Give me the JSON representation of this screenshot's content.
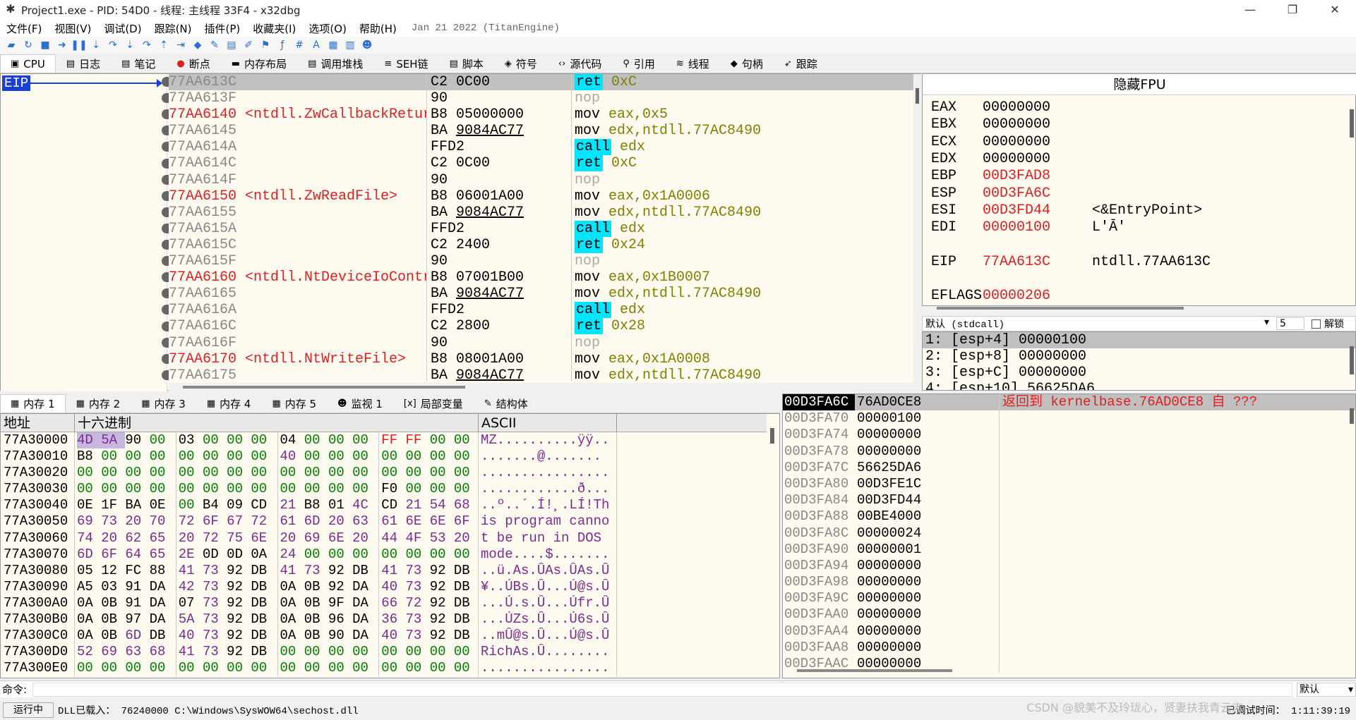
{
  "window": {
    "title": "Project1.exe - PID: 54D0 - 线程: 主线程 33F4 - x32dbg"
  },
  "menu": [
    "文件(F)",
    "视图(V)",
    "调试(D)",
    "跟踪(N)",
    "插件(P)",
    "收藏夹(I)",
    "选项(O)",
    "帮助(H)"
  ],
  "build_date": "Jan 21 2022 (TitanEngine)",
  "toolbar_icons": [
    "open-icon",
    "restart-icon",
    "stop-icon",
    "run-icon",
    "pause-icon",
    "step-into-icon",
    "step-over-icon",
    "step-into-2-icon",
    "step-over-2-icon",
    "run-to-user-icon",
    "trace-icon",
    "scylla-icon",
    "patch-icon",
    "comment-icon",
    "label-icon",
    "bookmark-icon",
    "function-icon",
    "hash-icon",
    "font-icon",
    "calc-icon",
    "notes-icon",
    "about-icon"
  ],
  "top_tabs": [
    {
      "label": "CPU",
      "icon": "cpu-icon"
    },
    {
      "label": "日志",
      "icon": "log-icon"
    },
    {
      "label": "笔记",
      "icon": "notes-icon"
    },
    {
      "label": "断点",
      "icon": "breakpoint-icon"
    },
    {
      "label": "内存布局",
      "icon": "memory-map-icon"
    },
    {
      "label": "调用堆栈",
      "icon": "callstack-icon"
    },
    {
      "label": "SEH链",
      "icon": "seh-icon"
    },
    {
      "label": "脚本",
      "icon": "script-icon"
    },
    {
      "label": "符号",
      "icon": "symbol-icon"
    },
    {
      "label": "源代码",
      "icon": "source-icon"
    },
    {
      "label": "引用",
      "icon": "search-icon"
    },
    {
      "label": "线程",
      "icon": "thread-icon"
    },
    {
      "label": "句柄",
      "icon": "handle-icon"
    },
    {
      "label": "跟踪",
      "icon": "trace-icon"
    }
  ],
  "eip_label": "EIP",
  "disasm": [
    {
      "addr": "77AA613C",
      "bytes": "C2 0C00",
      "op": "ret",
      "args": "0xC",
      "kind": "ret",
      "sel": true
    },
    {
      "addr": "77AA613F",
      "bytes": "90",
      "op": "nop",
      "args": "",
      "kind": "nop"
    },
    {
      "addr": "77AA6140 <ntdll.ZwCallbackRetur",
      "bytes": "B8 05000000",
      "op": "mov",
      "args": "eax,0x5",
      "kind": "mov",
      "label": true
    },
    {
      "addr": "77AA6145",
      "bytes": "BA 9084AC77",
      "op": "mov",
      "args": "edx,ntdll.77AC8490",
      "kind": "mov",
      "u": true
    },
    {
      "addr": "77AA614A",
      "bytes": "FFD2",
      "op": "call",
      "args": "edx",
      "kind": "call"
    },
    {
      "addr": "77AA614C",
      "bytes": "C2 0C00",
      "op": "ret",
      "args": "0xC",
      "kind": "ret"
    },
    {
      "addr": "77AA614F",
      "bytes": "90",
      "op": "nop",
      "args": "",
      "kind": "nop"
    },
    {
      "addr": "77AA6150 <ntdll.ZwReadFile>",
      "bytes": "B8 06001A00",
      "op": "mov",
      "args": "eax,0x1A0006",
      "kind": "mov",
      "label": true
    },
    {
      "addr": "77AA6155",
      "bytes": "BA 9084AC77",
      "op": "mov",
      "args": "edx,ntdll.77AC8490",
      "kind": "mov",
      "u": true
    },
    {
      "addr": "77AA615A",
      "bytes": "FFD2",
      "op": "call",
      "args": "edx",
      "kind": "call"
    },
    {
      "addr": "77AA615C",
      "bytes": "C2 2400",
      "op": "ret",
      "args": "0x24",
      "kind": "ret"
    },
    {
      "addr": "77AA615F",
      "bytes": "90",
      "op": "nop",
      "args": "",
      "kind": "nop"
    },
    {
      "addr": "77AA6160 <ntdll.NtDeviceIoContr",
      "bytes": "B8 07001B00",
      "op": "mov",
      "args": "eax,0x1B0007",
      "kind": "mov",
      "label": true
    },
    {
      "addr": "77AA6165",
      "bytes": "BA 9084AC77",
      "op": "mov",
      "args": "edx,ntdll.77AC8490",
      "kind": "mov",
      "u": true
    },
    {
      "addr": "77AA616A",
      "bytes": "FFD2",
      "op": "call",
      "args": "edx",
      "kind": "call"
    },
    {
      "addr": "77AA616C",
      "bytes": "C2 2800",
      "op": "ret",
      "args": "0x28",
      "kind": "ret"
    },
    {
      "addr": "77AA616F",
      "bytes": "90",
      "op": "nop",
      "args": "",
      "kind": "nop"
    },
    {
      "addr": "77AA6170 <ntdll.NtWriteFile>",
      "bytes": "B8 08001A00",
      "op": "mov",
      "args": "eax,0x1A0008",
      "kind": "mov",
      "label": true
    },
    {
      "addr": "77AA6175",
      "bytes": "BA 9084AC77",
      "op": "mov",
      "args": "edx,ntdll.77AC8490",
      "kind": "mov",
      "u": true
    }
  ],
  "fpu_button": "隐藏FPU",
  "registers": [
    {
      "name": "EAX",
      "value": "00000000",
      "red": false,
      "comment": ""
    },
    {
      "name": "EBX",
      "value": "00000000",
      "red": false,
      "comment": ""
    },
    {
      "name": "ECX",
      "value": "00000000",
      "red": false,
      "comment": ""
    },
    {
      "name": "EDX",
      "value": "00000000",
      "red": false,
      "comment": ""
    },
    {
      "name": "EBP",
      "value": "00D3FAD8",
      "red": true,
      "comment": ""
    },
    {
      "name": "ESP",
      "value": "00D3FA6C",
      "red": true,
      "comment": ""
    },
    {
      "name": "ESI",
      "value": "00D3FD44",
      "red": true,
      "comment": "<&EntryPoint>"
    },
    {
      "name": "EDI",
      "value": "00000100",
      "red": true,
      "comment": "L'Ā'"
    },
    {
      "name": "",
      "value": "",
      "red": false,
      "comment": ""
    },
    {
      "name": "EIP",
      "value": "77AA613C",
      "red": true,
      "comment": "ntdll.77AA613C"
    },
    {
      "name": "",
      "value": "",
      "red": false,
      "comment": ""
    },
    {
      "name": "EFLAGS",
      "value": "00000206",
      "red": true,
      "comment": ""
    }
  ],
  "callconv": {
    "selected": "默认 (stdcall)",
    "count": "5",
    "unlock_label": "解锁"
  },
  "args": [
    {
      "text": "1: [esp+4]  00000100",
      "sel": true
    },
    {
      "text": "2: [esp+8]  00000000",
      "sel": false
    },
    {
      "text": "3: [esp+C]  00000000",
      "sel": false
    },
    {
      "text": "4: [esp+10] 56625DA6",
      "sel": false
    }
  ],
  "bottom_tabs": [
    {
      "label": "内存 1",
      "icon": "dump-icon"
    },
    {
      "label": "内存 2",
      "icon": "dump-icon"
    },
    {
      "label": "内存 3",
      "icon": "dump-icon"
    },
    {
      "label": "内存 4",
      "icon": "dump-icon"
    },
    {
      "label": "内存 5",
      "icon": "dump-icon"
    },
    {
      "label": "监视 1",
      "icon": "watch-icon"
    },
    {
      "label": "局部变量",
      "icon": "locals-icon"
    },
    {
      "label": "结构体",
      "icon": "struct-icon"
    }
  ],
  "dump_headers": {
    "addr": "地址",
    "hex": "十六进制",
    "ascii": "ASCII"
  },
  "dump_rows": [
    {
      "addr": "77A30000",
      "hex": [
        "4D",
        "5A",
        "90",
        "00",
        "03",
        "00",
        "00",
        "00",
        "04",
        "00",
        "00",
        "00",
        "FF",
        "FF",
        "00",
        "00"
      ],
      "ascii": "MZ..........ÿÿ.."
    },
    {
      "addr": "77A30010",
      "hex": [
        "B8",
        "00",
        "00",
        "00",
        "00",
        "00",
        "00",
        "00",
        "40",
        "00",
        "00",
        "00",
        "00",
        "00",
        "00",
        "00"
      ],
      "ascii": ".......@......."
    },
    {
      "addr": "77A30020",
      "hex": [
        "00",
        "00",
        "00",
        "00",
        "00",
        "00",
        "00",
        "00",
        "00",
        "00",
        "00",
        "00",
        "00",
        "00",
        "00",
        "00"
      ],
      "ascii": "................"
    },
    {
      "addr": "77A30030",
      "hex": [
        "00",
        "00",
        "00",
        "00",
        "00",
        "00",
        "00",
        "00",
        "00",
        "00",
        "00",
        "00",
        "F0",
        "00",
        "00",
        "00"
      ],
      "ascii": "............ð..."
    },
    {
      "addr": "77A30040",
      "hex": [
        "0E",
        "1F",
        "BA",
        "0E",
        "00",
        "B4",
        "09",
        "CD",
        "21",
        "B8",
        "01",
        "4C",
        "CD",
        "21",
        "54",
        "68"
      ],
      "ascii": "..º..´.Í!¸.LÍ!Th"
    },
    {
      "addr": "77A30050",
      "hex": [
        "69",
        "73",
        "20",
        "70",
        "72",
        "6F",
        "67",
        "72",
        "61",
        "6D",
        "20",
        "63",
        "61",
        "6E",
        "6E",
        "6F"
      ],
      "ascii": "is program canno"
    },
    {
      "addr": "77A30060",
      "hex": [
        "74",
        "20",
        "62",
        "65",
        "20",
        "72",
        "75",
        "6E",
        "20",
        "69",
        "6E",
        "20",
        "44",
        "4F",
        "53",
        "20"
      ],
      "ascii": "t be run in DOS "
    },
    {
      "addr": "77A30070",
      "hex": [
        "6D",
        "6F",
        "64",
        "65",
        "2E",
        "0D",
        "0D",
        "0A",
        "24",
        "00",
        "00",
        "00",
        "00",
        "00",
        "00",
        "00"
      ],
      "ascii": "mode....$......."
    },
    {
      "addr": "77A30080",
      "hex": [
        "05",
        "12",
        "FC",
        "88",
        "41",
        "73",
        "92",
        "DB",
        "41",
        "73",
        "92",
        "DB",
        "41",
        "73",
        "92",
        "DB"
      ],
      "ascii": "..ü.As.ÛAs.ÛAs.Û"
    },
    {
      "addr": "77A30090",
      "hex": [
        "A5",
        "03",
        "91",
        "DA",
        "42",
        "73",
        "92",
        "DB",
        "0A",
        "0B",
        "92",
        "DA",
        "40",
        "73",
        "92",
        "DB"
      ],
      "ascii": "¥..ÚBs.Û...Ú@s.Û"
    },
    {
      "addr": "77A300A0",
      "hex": [
        "0A",
        "0B",
        "91",
        "DA",
        "07",
        "73",
        "92",
        "DB",
        "0A",
        "0B",
        "9F",
        "DA",
        "66",
        "72",
        "92",
        "DB"
      ],
      "ascii": "...Ú.s.Û...Úfr.Û"
    },
    {
      "addr": "77A300B0",
      "hex": [
        "0A",
        "0B",
        "97",
        "DA",
        "5A",
        "73",
        "92",
        "DB",
        "0A",
        "0B",
        "96",
        "DA",
        "36",
        "73",
        "92",
        "DB"
      ],
      "ascii": "...ÚZs.Û...Ú6s.Û"
    },
    {
      "addr": "77A300C0",
      "hex": [
        "0A",
        "0B",
        "6D",
        "DB",
        "40",
        "73",
        "92",
        "DB",
        "0A",
        "0B",
        "90",
        "DA",
        "40",
        "73",
        "92",
        "DB"
      ],
      "ascii": "..mÛ@s.Û...Ú@s.Û"
    },
    {
      "addr": "77A300D0",
      "hex": [
        "52",
        "69",
        "63",
        "68",
        "41",
        "73",
        "92",
        "DB",
        "00",
        "00",
        "00",
        "00",
        "00",
        "00",
        "00",
        "00"
      ],
      "ascii": "RichAs.Û........"
    },
    {
      "addr": "77A300E0",
      "hex": [
        "00",
        "00",
        "00",
        "00",
        "00",
        "00",
        "00",
        "00",
        "00",
        "00",
        "00",
        "00",
        "00",
        "00",
        "00",
        "00"
      ],
      "ascii": "................"
    }
  ],
  "stack": [
    {
      "addr": "00D3FA6C",
      "val": "76AD0CE8",
      "comment": "返回到 kernelbase.76AD0CE8 自 ???",
      "cur": true
    },
    {
      "addr": "00D3FA70",
      "val": "00000100",
      "comment": ""
    },
    {
      "addr": "00D3FA74",
      "val": "00000000",
      "comment": ""
    },
    {
      "addr": "00D3FA78",
      "val": "00000000",
      "comment": ""
    },
    {
      "addr": "00D3FA7C",
      "val": "56625DA6",
      "comment": ""
    },
    {
      "addr": "00D3FA80",
      "val": "00D3FE1C",
      "comment": ""
    },
    {
      "addr": "00D3FA84",
      "val": "00D3FD44",
      "comment": ""
    },
    {
      "addr": "00D3FA88",
      "val": "00BE4000",
      "comment": ""
    },
    {
      "addr": "00D3FA8C",
      "val": "00000024",
      "comment": ""
    },
    {
      "addr": "00D3FA90",
      "val": "00000001",
      "comment": ""
    },
    {
      "addr": "00D3FA94",
      "val": "00000000",
      "comment": ""
    },
    {
      "addr": "00D3FA98",
      "val": "00000000",
      "comment": ""
    },
    {
      "addr": "00D3FA9C",
      "val": "00000000",
      "comment": ""
    },
    {
      "addr": "00D3FAA0",
      "val": "00000000",
      "comment": ""
    },
    {
      "addr": "00D3FAA4",
      "val": "00000000",
      "comment": ""
    },
    {
      "addr": "00D3FAA8",
      "val": "00000000",
      "comment": ""
    },
    {
      "addr": "00D3FAAC",
      "val": "00000000",
      "comment": ""
    }
  ],
  "cmd": {
    "label": "命令:",
    "placeholder": "",
    "mode": "默认"
  },
  "status": {
    "state": "运行中",
    "message": "DLL已载入： 76240000 C:\\Windows\\SysWOW64\\sechost.dll",
    "debug_time": "已调试时间： 1:11:39:19"
  },
  "watermark": "CSDN @貌美不及玲珑心，贤妻扶我青云志"
}
